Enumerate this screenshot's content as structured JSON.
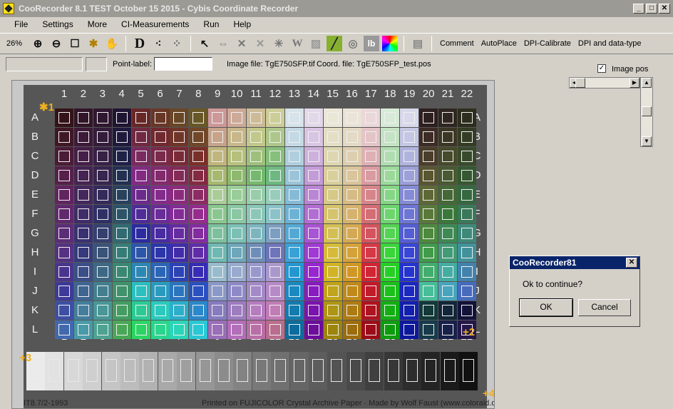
{
  "window": {
    "title": "CooRecorder 8.1 TEST October 15 2015 - Cybis Coordinate Recorder",
    "controls": [
      "_",
      "□",
      "✕"
    ]
  },
  "menu": [
    "File",
    "Settings",
    "More",
    "CI-Measurements",
    "Run",
    "Help"
  ],
  "toolbar": {
    "zoom": "26%",
    "text_buttons": [
      "Comment",
      "AutoPlace",
      "DPI-Calibrate",
      "DPI and data-type"
    ]
  },
  "row2": {
    "point_label": "Point-label:",
    "point_value": "",
    "image_file": "Image file: TgE750SFP.tif",
    "coord_file": "Coord. file: TgE750SFP_test.pos",
    "image_pos_label": "Image pos",
    "image_pos_checked": "✓"
  },
  "target": {
    "columns": [
      "1",
      "2",
      "3",
      "4",
      "5",
      "6",
      "7",
      "8",
      "9",
      "10",
      "11",
      "12",
      "13",
      "14",
      "15",
      "16",
      "17",
      "18",
      "19",
      "20",
      "21",
      "22"
    ],
    "rows": [
      "A",
      "B",
      "C",
      "D",
      "E",
      "F",
      "G",
      "H",
      "I",
      "J",
      "K",
      "L"
    ],
    "footer_left": "IT8.7/2-1993",
    "footer_right": "Printed on FUJICOLOR Crystal Archive Paper  ·  Made by Wolf Faust (www.coloraid.de)",
    "markers": [
      "1",
      "2",
      "3",
      "4"
    ]
  },
  "dialog": {
    "title": "CooRecorder81",
    "close": "✕",
    "message": "Ok to continue?",
    "ok": "OK",
    "cancel": "Cancel"
  },
  "colors": {
    "titlebar": "#9c9a94",
    "dialog_titlebar": "#0a246a",
    "marker": "#f0b020"
  }
}
